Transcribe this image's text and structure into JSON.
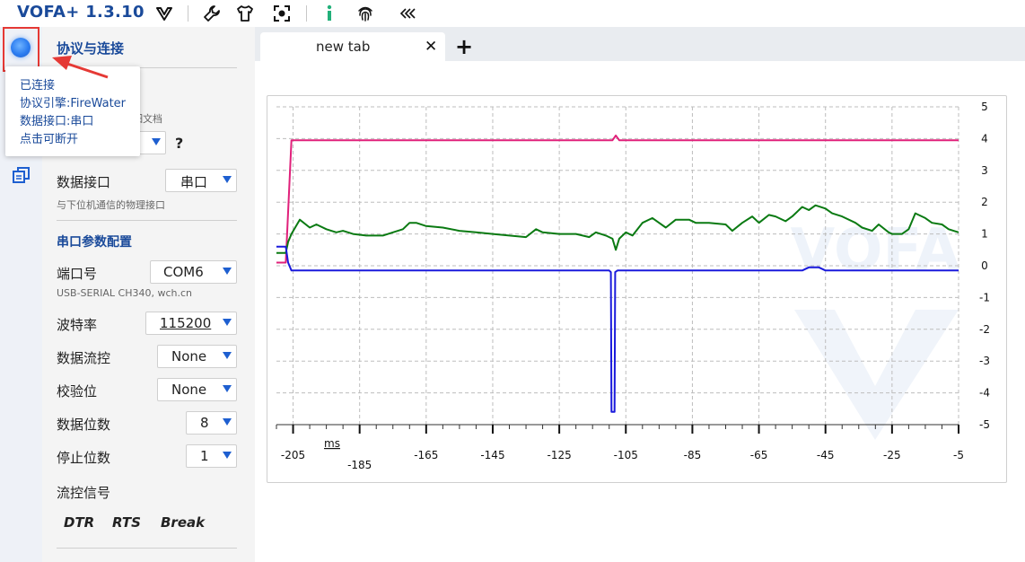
{
  "app": {
    "title": "VOFA+ 1.3.10"
  },
  "toolbar": {
    "icons": [
      "vofa-logo-icon",
      "wrench-icon",
      "shirt-icon",
      "screenshot-icon",
      "info-icon",
      "fingerprint-icon",
      "collapse-icon"
    ]
  },
  "connection": {
    "state": "connected",
    "tooltip": {
      "line1": "已连接",
      "line2": "协议引擎:FireWater",
      "line3": "数据接口:串口",
      "line4": "点击可断开"
    }
  },
  "panel": {
    "section_title": "协议与连接",
    "protocol_doc_hint_partial": "细文档",
    "protocol_help": "?",
    "interface_label": "数据接口",
    "interface_value": "串口",
    "interface_hint": "与下位机通信的物理接口",
    "serial_section_title": "串口参数配置",
    "port_label": "端口号",
    "port_value": "COM6",
    "port_hint": "USB-SERIAL CH340, wch.cn",
    "baud_label": "波特率",
    "baud_value": "115200",
    "flow_label": "数据流控",
    "flow_value": "None",
    "parity_label": "校验位",
    "parity_value": "None",
    "databits_label": "数据位数",
    "databits_value": "8",
    "stopbits_label": "停止位数",
    "stopbits_value": "1",
    "signals_label": "流控信号",
    "signals": {
      "dtr": "DTR",
      "rts": "RTS",
      "brk": "Break"
    }
  },
  "tabs": {
    "items": [
      {
        "label": "new tab",
        "close": "✕"
      }
    ],
    "add": "+"
  },
  "accent_colors": {
    "primary": "#1e5fd0",
    "title": "#1a4a9a",
    "highlight": "#e53935"
  },
  "chart_data": {
    "type": "line",
    "watermark": "VOFA",
    "x_unit_label": "ms",
    "xlim": [
      -210,
      -5
    ],
    "ylim": [
      -5,
      5
    ],
    "x_ticks": [
      -205,
      -185,
      -165,
      -145,
      -125,
      -105,
      -85,
      -65,
      -45,
      -25,
      -5
    ],
    "y_ticks": [
      5,
      4,
      3,
      2,
      1,
      0,
      -1,
      -2,
      -3,
      -4,
      -5
    ],
    "grid": true,
    "series": [
      {
        "color": "#e0207a",
        "x": [
          -210,
          -207.2,
          -205.5,
          -109,
          -108,
          -107,
          -5
        ],
        "y": [
          0.1,
          0.1,
          3.95,
          3.95,
          4.1,
          3.95,
          3.95
        ]
      },
      {
        "color": "#0a7a12",
        "x": [
          -210,
          -207.2,
          -206.5,
          -205.5,
          -203,
          -200,
          -198,
          -195,
          -192,
          -190,
          -187,
          -183,
          -178,
          -175,
          -172,
          -170,
          -168,
          -165,
          -160,
          -155,
          -150,
          -145,
          -140,
          -135,
          -132,
          -130,
          -125,
          -122,
          -120,
          -116,
          -114,
          -111,
          -109,
          -108,
          -107,
          -105,
          -103,
          -100,
          -97,
          -95,
          -93,
          -90,
          -86,
          -84,
          -80,
          -75,
          -73,
          -70,
          -67,
          -65,
          -62,
          -60,
          -57,
          -55,
          -52,
          -50,
          -48,
          -45,
          -43,
          -40,
          -36,
          -34,
          -31,
          -29,
          -26,
          -25,
          -22,
          -20,
          -18,
          -15,
          -13,
          -10,
          -8,
          -5
        ],
        "y": [
          0.4,
          0.4,
          0.75,
          1.0,
          1.45,
          1.2,
          1.3,
          1.15,
          1.05,
          1.1,
          1.0,
          0.95,
          0.95,
          1.05,
          1.15,
          1.35,
          1.35,
          1.25,
          1.2,
          1.1,
          1.05,
          1.0,
          0.95,
          0.9,
          1.15,
          1.05,
          1.0,
          1.0,
          1.0,
          0.9,
          1.05,
          0.95,
          0.85,
          0.5,
          0.85,
          1.05,
          0.95,
          1.35,
          1.5,
          1.35,
          1.2,
          1.45,
          1.45,
          1.35,
          1.35,
          1.3,
          1.1,
          1.35,
          1.55,
          1.35,
          1.6,
          1.55,
          1.4,
          1.55,
          1.85,
          1.75,
          1.9,
          1.8,
          1.65,
          1.55,
          1.35,
          1.2,
          1.1,
          1.3,
          1.05,
          1.0,
          1.0,
          1.15,
          1.65,
          1.5,
          1.35,
          1.3,
          1.15,
          1.05
        ]
      },
      {
        "color": "#1a1adc",
        "x": [
          -210,
          -207.2,
          -206.5,
          -205.5,
          -110,
          -109.5,
          -109.3,
          -108.4,
          -108.2,
          -107.5,
          -52,
          -50,
          -48,
          -47,
          -45,
          -5
        ],
        "y": [
          0.6,
          0.6,
          0.1,
          -0.15,
          -0.15,
          -0.2,
          -4.6,
          -4.6,
          -0.2,
          -0.15,
          -0.15,
          -0.05,
          -0.05,
          -0.05,
          -0.15,
          -0.15
        ]
      }
    ]
  }
}
